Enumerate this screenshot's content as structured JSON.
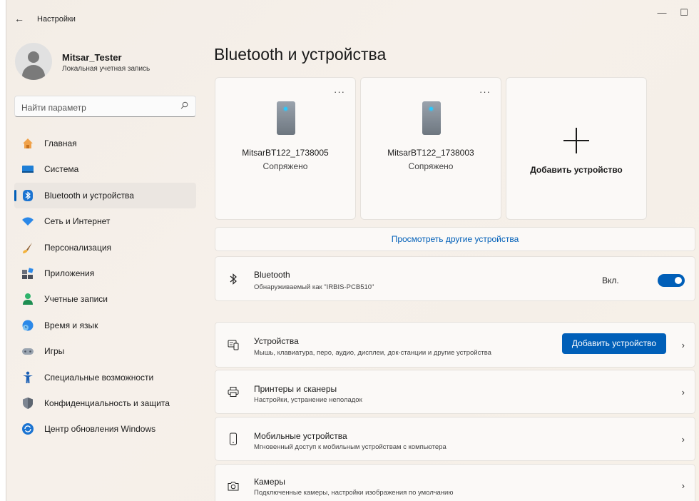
{
  "window": {
    "title": "Настройки",
    "back_icon": "arrow-left-icon",
    "controls": {
      "minimize": "—",
      "maximize": "☐",
      "close": "✕"
    }
  },
  "user": {
    "name": "Mitsar_Tester",
    "account_type": "Локальная учетная запись"
  },
  "search": {
    "placeholder": "Найти параметр",
    "icon": "search-icon"
  },
  "sidebar": {
    "items": [
      {
        "label": "Главная",
        "icon": "home-icon",
        "active": false
      },
      {
        "label": "Система",
        "icon": "system-icon",
        "active": false
      },
      {
        "label": "Bluetooth и устройства",
        "icon": "bluetooth-icon",
        "active": true
      },
      {
        "label": "Сеть и Интернет",
        "icon": "wifi-icon",
        "active": false
      },
      {
        "label": "Персонализация",
        "icon": "brush-icon",
        "active": false
      },
      {
        "label": "Приложения",
        "icon": "apps-icon",
        "active": false
      },
      {
        "label": "Учетные записи",
        "icon": "account-icon",
        "active": false
      },
      {
        "label": "Время и язык",
        "icon": "globe-clock-icon",
        "active": false
      },
      {
        "label": "Игры",
        "icon": "gamepad-icon",
        "active": false
      },
      {
        "label": "Специальные возможности",
        "icon": "accessibility-icon",
        "active": false
      },
      {
        "label": "Конфиденциальность и защита",
        "icon": "shield-icon",
        "active": false
      },
      {
        "label": "Центр обновления Windows",
        "icon": "update-icon",
        "active": false
      }
    ]
  },
  "main": {
    "title": "Bluetooth и устройства",
    "devices": [
      {
        "name": "MitsarBT122_1738005",
        "status": "Сопряжено",
        "menu": "···"
      },
      {
        "name": "MitsarBT122_1738003",
        "status": "Сопряжено",
        "menu": "···"
      }
    ],
    "add_card_label": "Добавить устройство",
    "more_devices_link": "Просмотреть другие устройства",
    "bluetooth": {
      "title": "Bluetooth",
      "subtitle": "Обнаруживаемый как \"IRBIS-PCB510\"",
      "state_label": "Вкл.",
      "enabled": true
    },
    "settings_rows": [
      {
        "title": "Устройства",
        "subtitle": "Мышь, клавиатура, перо, аудио, дисплеи, док-станции и другие устройства",
        "icon": "keyboard-icon",
        "button": "Добавить устройство"
      },
      {
        "title": "Принтеры и сканеры",
        "subtitle": "Настройки, устранение неполадок",
        "icon": "printer-icon"
      },
      {
        "title": "Мобильные устройства",
        "subtitle": "Мгновенный доступ к мобильным устройствам с компьютера",
        "icon": "phone-icon"
      },
      {
        "title": "Камеры",
        "subtitle": "Подключенные камеры, настройки изображения по умолчанию",
        "icon": "camera-icon"
      }
    ],
    "chevron": "›",
    "accent": "#005fb8"
  }
}
